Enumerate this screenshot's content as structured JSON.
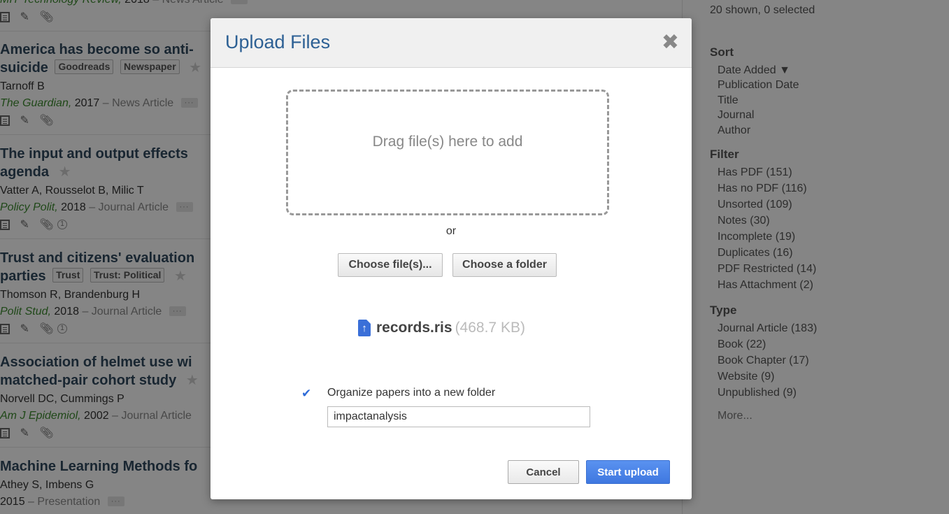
{
  "papers": [
    {
      "title_lines": [
        "MIT Technology Review,"
      ],
      "journal": "MIT Technology Review,",
      "year": "2018",
      "type": "– News Article"
    },
    {
      "title_line1": "America has become so anti-",
      "title_line2": "suicide",
      "tags": [
        "Goodreads",
        "Newspaper"
      ],
      "authors": "Tarnoff B",
      "journal": "The Guardian,",
      "year": "2017",
      "type": "– News Article"
    },
    {
      "title_line1": "The input and output effects",
      "title_line2": "agenda",
      "tags": [],
      "authors": "Vatter A, Rousselot B, Milic T",
      "journal": "Policy Polit,",
      "year": "2018",
      "type": "– Journal Article",
      "attachments": "1"
    },
    {
      "title_line1": "Trust and citizens' evaluation",
      "title_line2": "parties",
      "tags": [
        "Trust",
        "Trust: Political"
      ],
      "authors": "Thomson R, Brandenburg H",
      "journal": "Polit Stud,",
      "year": "2018",
      "type": "– Journal Article",
      "attachments": "1"
    },
    {
      "title_line1": "Association of helmet use wi",
      "title_line2": "matched-pair cohort study",
      "tags": [],
      "authors": "Norvell DC, Cummings P",
      "journal": "Am J Epidemiol,",
      "year": "2002",
      "type": "– Journal Article"
    },
    {
      "title_line1": "Machine Learning Methods fo",
      "authors": "Athey S, Imbens G",
      "year": "2015",
      "type": "– Presentation"
    }
  ],
  "more_label": "···",
  "sidebar": {
    "status": "20 shown, 0 selected",
    "sort_heading": "Sort",
    "sort_items": [
      "Date Added ▼",
      "Publication Date",
      "Title",
      "Journal",
      "Author"
    ],
    "filter_heading": "Filter",
    "filter_items": [
      "Has PDF (151)",
      "Has no PDF (116)",
      "Unsorted (109)",
      "Notes (30)",
      "Incomplete (19)",
      "Duplicates (16)",
      "PDF Restricted (14)",
      "Has Attachment (2)"
    ],
    "type_heading": "Type",
    "type_items": [
      "Journal Article (183)",
      "Book (22)",
      "Book Chapter (17)",
      "Website (9)",
      "Unpublished (9)"
    ],
    "more": "More..."
  },
  "modal": {
    "title": "Upload Files",
    "close": "✖",
    "dropzone_text": "Drag file(s) here to add",
    "or": "or",
    "choose_files": "Choose file(s)...",
    "choose_folder": "Choose a folder",
    "file": {
      "name": "records.ris",
      "size": "(468.7 KB)",
      "icon": "upload-file-icon"
    },
    "organize_label": "Organize papers into a new folder",
    "organize_checked": true,
    "folder_value": "impactanalysis",
    "cancel": "Cancel",
    "start": "Start upload"
  }
}
